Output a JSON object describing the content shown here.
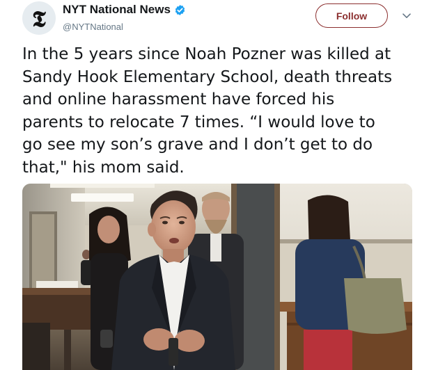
{
  "account": {
    "display_name": "NYT National News",
    "handle": "@NYTNational",
    "verified": true,
    "avatar_icon": "nyt-t-logo-icon"
  },
  "actions": {
    "follow_label": "Follow",
    "more_icon": "chevron-down-icon"
  },
  "tweet": {
    "lines": [
      "In the 5 years since Noah Pozner was killed at",
      "Sandy Hook Elementary School, death threats",
      "and online harassment have forced his",
      "parents to relocate 7 times. “I would love to",
      "go see my son’s grave and I don’t get to do",
      "that,\" his mom said."
    ]
  },
  "media": {
    "type": "photo"
  },
  "colors": {
    "follow_accent": "#8b2e2e",
    "verified_blue": "#1da1f2",
    "secondary_text": "#657786"
  }
}
